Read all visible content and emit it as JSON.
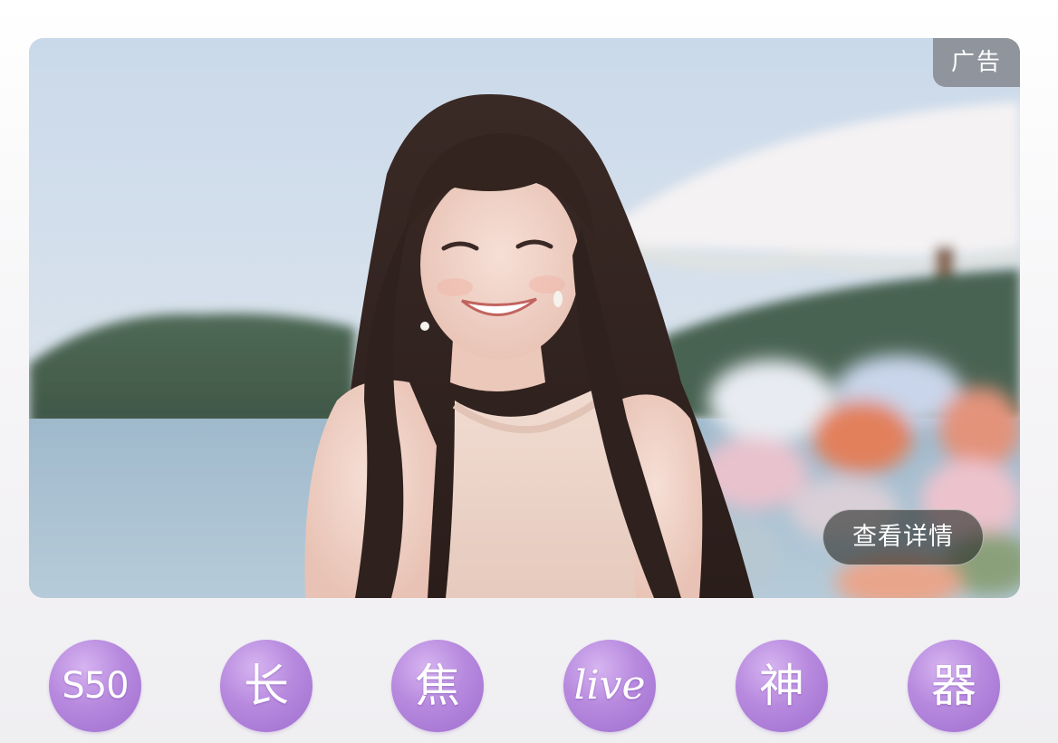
{
  "banner": {
    "ad_label": "广告",
    "details_button": "查看详情"
  },
  "badges": [
    {
      "label": "S50",
      "name": "badge-s50"
    },
    {
      "label": "长",
      "name": "badge-chang"
    },
    {
      "label": "焦",
      "name": "badge-jiao"
    },
    {
      "label": "live",
      "name": "badge-live"
    },
    {
      "label": "神",
      "name": "badge-shen"
    },
    {
      "label": "器",
      "name": "badge-qi"
    }
  ],
  "colors": {
    "badge_purple": "#b789de",
    "ad_tag_bg": "#78787f",
    "details_button_bg": "#2c302c"
  }
}
